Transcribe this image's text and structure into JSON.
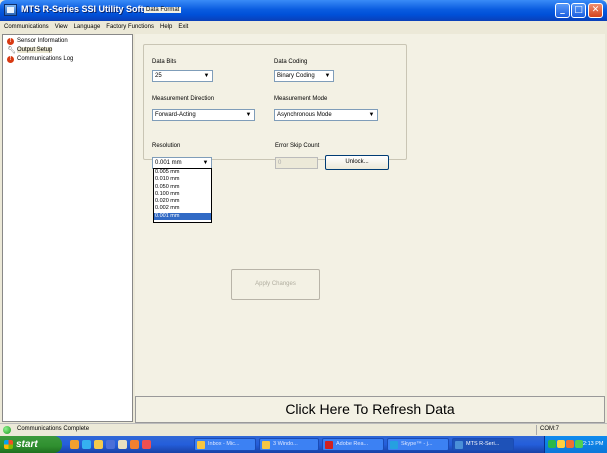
{
  "window": {
    "title": "MTS R-Series SSI Utility Software",
    "minimize": "_",
    "maximize": "□",
    "close": "✕"
  },
  "menu": [
    "Communications",
    "View",
    "Language",
    "Factory Functions",
    "Help",
    "Exit"
  ],
  "tree": {
    "items": [
      {
        "label": "Sensor Information",
        "icon": "error-icon"
      },
      {
        "label": "Output Setup",
        "icon": "wrench-icon",
        "selected": true
      },
      {
        "label": "Communications Log",
        "icon": "error-icon"
      }
    ]
  },
  "data_format": {
    "group_title": "Data Format",
    "data_bits_label": "Data Bits",
    "data_bits_value": "25",
    "data_coding_label": "Data Coding",
    "data_coding_value": "Binary Coding",
    "direction_label": "Measurement Direction",
    "direction_value": "Forward-Acting",
    "mode_label": "Measurement Mode",
    "mode_value": "Asynchronous Mode"
  },
  "resolution": {
    "label": "Resolution",
    "value": "0.001 mm",
    "options": [
      "0.005 mm",
      "0.010 mm",
      "0.050 mm",
      "0.100 mm",
      "0.020 mm",
      "0.002 mm",
      "0.001 mm"
    ],
    "selected_index": 6
  },
  "error_skip": {
    "label": "Error Skip Count",
    "value": "0",
    "unlock_label": "Unlock..."
  },
  "apply_label": "Apply Changes",
  "refresh_label": "Click Here To Refresh Data",
  "status": {
    "text": "Communications Complete",
    "port": "COM:7"
  },
  "taskbar": {
    "start": "start",
    "buttons": [
      {
        "label": "Inbox - Mic...",
        "color": "#f6c642"
      },
      {
        "label": "3 Windo...",
        "color": "#f6c642"
      },
      {
        "label": "Adobe Rea...",
        "color": "#d02020"
      },
      {
        "label": "Skype™ - j...",
        "color": "#25a0e0"
      },
      {
        "label": "MTS R-Seri...",
        "color": "#4a8fd8",
        "active": true
      }
    ],
    "clock": "2:13 PM"
  }
}
